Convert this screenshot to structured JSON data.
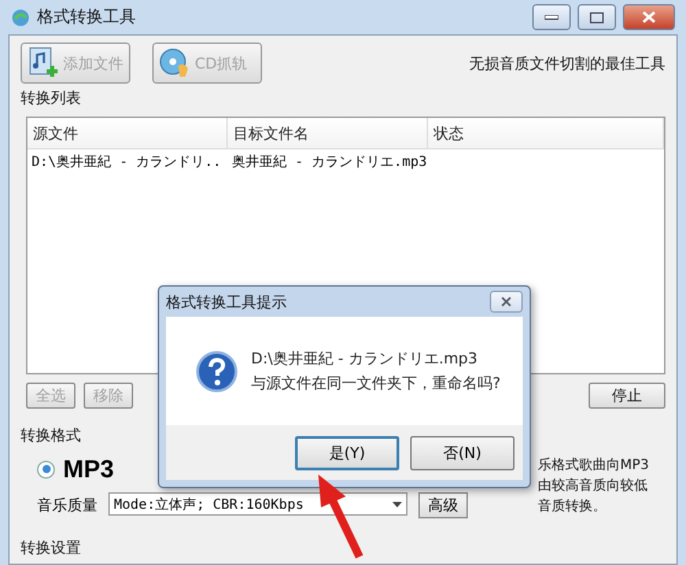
{
  "window": {
    "title": "格式转换工具"
  },
  "toolbar": [
    {
      "kind": "add",
      "label": "添加文件",
      "disabled": true
    },
    {
      "kind": "cd",
      "label": "CD抓轨",
      "disabled": true
    }
  ],
  "slogan": "无损音质文件切割的最佳工具",
  "list_group": {
    "title": "转换列表",
    "columns": [
      "源文件",
      "目标文件名",
      "状态"
    ],
    "rows": [
      {
        "source": "D:\\奥井亜紀 - カランドリ..",
        "target": "奥井亜紀 - カランドリエ.mp3"
      }
    ],
    "buttons": [
      {
        "label": "全选",
        "disabled": true
      },
      {
        "label": "移除",
        "disabled": true
      },
      {
        "label": "停止",
        "disabled": false
      }
    ]
  },
  "format_group": {
    "title": "转换格式",
    "options": [
      {
        "label": "MP3",
        "selected": true
      }
    ],
    "quality_label": "音乐质量",
    "quality_value": "Mode:立体声; CBR:160Kbps",
    "advanced_button": "高级",
    "description": [
      "乐格式歌曲向MP3",
      "由较高音质向较低",
      "音质转换。"
    ]
  },
  "settings_group": {
    "title": "转换设置"
  },
  "dialog": {
    "title": "格式转换工具提示",
    "message": [
      "D:\\奥井亜紀 - カランドリエ.mp3",
      "与源文件在同一文件夹下，重命名吗?"
    ],
    "buttons": [
      {
        "label": "是(Y)",
        "focused": true
      },
      {
        "label": "否(N)",
        "focused": false
      }
    ]
  }
}
